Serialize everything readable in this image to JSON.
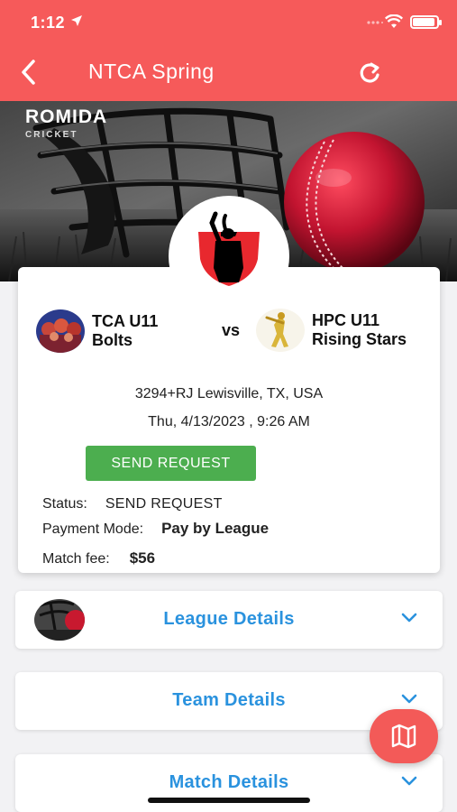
{
  "status_bar": {
    "time": "1:12"
  },
  "header": {
    "title": "NTCA Spring"
  },
  "banner": {
    "brand": "ROMIDA",
    "brand_sub": "CRICKET"
  },
  "match": {
    "team_a": {
      "line1": "TCA U11",
      "line2": "Bolts"
    },
    "vs": "vs",
    "team_b": {
      "line1": "HPC U11",
      "line2": "Rising Stars"
    },
    "venue": "3294+RJ Lewisville, TX, USA",
    "datetime": "Thu, 4/13/2023 , 9:26 AM",
    "send_request_label": "SEND REQUEST",
    "status_label": "Status:",
    "status_value": "SEND REQUEST",
    "payment_label": "Payment Mode:",
    "payment_value": "Pay by League",
    "fee_label": "Match fee:",
    "fee_value": "$56"
  },
  "sections": [
    {
      "label": "League Details"
    },
    {
      "label": "Team Details"
    },
    {
      "label": "Match Details"
    }
  ],
  "icons": {
    "back": "chevron-left-icon",
    "refresh": "refresh-icon",
    "map": "map-icon",
    "expand": "chevron-down-icon"
  },
  "colors": {
    "header_bg": "#f65a5a",
    "send_button": "#4cae4f",
    "section_label": "#2a92de",
    "fab": "#f35a58"
  }
}
